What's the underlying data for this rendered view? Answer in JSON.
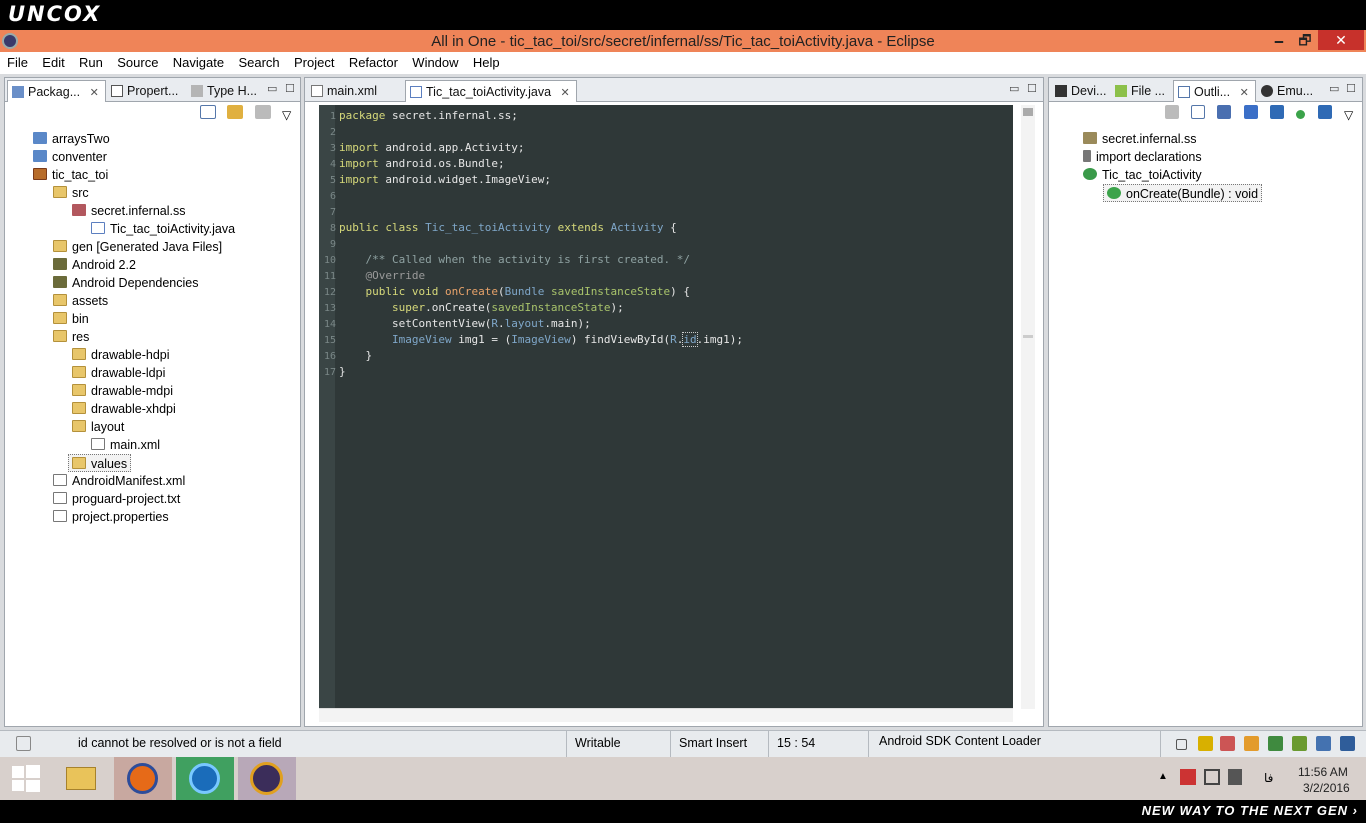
{
  "banner": {
    "logo": "UNCOX",
    "tagline": "NEW WAY TO THE NEXT GEN ›"
  },
  "window": {
    "title": "All in One - tic_tac_toi/src/secret/infernal/ss/Tic_tac_toiActivity.java - Eclipse",
    "min": "🗕",
    "max": "🗗",
    "close": "✕"
  },
  "menu": [
    "File",
    "Edit",
    "Run",
    "Source",
    "Navigate",
    "Search",
    "Project",
    "Refactor",
    "Window",
    "Help"
  ],
  "left_view": {
    "tabs": [
      "Packag...",
      "Propert...",
      "Type H..."
    ],
    "tree": [
      {
        "label": "arraysTwo",
        "icon": "project-icon"
      },
      {
        "label": "conventer",
        "icon": "project-icon"
      },
      {
        "label": "tic_tac_toi",
        "icon": "project-icon"
      },
      {
        "label": "src",
        "icon": "folder-icon"
      },
      {
        "label": "secret.infernal.ss",
        "icon": "package-icon"
      },
      {
        "label": "Tic_tac_toiActivity.java",
        "icon": "java-file-icon"
      },
      {
        "label": "gen [Generated Java Files]",
        "icon": "folder-icon"
      },
      {
        "label": "Android 2.2",
        "icon": "library-icon"
      },
      {
        "label": "Android Dependencies",
        "icon": "library-icon"
      },
      {
        "label": "assets",
        "icon": "folder-icon"
      },
      {
        "label": "bin",
        "icon": "folder-icon"
      },
      {
        "label": "res",
        "icon": "folder-icon"
      },
      {
        "label": "drawable-hdpi",
        "icon": "folder-icon"
      },
      {
        "label": "drawable-ldpi",
        "icon": "folder-icon"
      },
      {
        "label": "drawable-mdpi",
        "icon": "folder-icon"
      },
      {
        "label": "drawable-xhdpi",
        "icon": "folder-icon"
      },
      {
        "label": "layout",
        "icon": "folder-icon"
      },
      {
        "label": "main.xml",
        "icon": "xml-file-icon"
      },
      {
        "label": "values",
        "icon": "folder-icon"
      },
      {
        "label": "AndroidManifest.xml",
        "icon": "file-icon"
      },
      {
        "label": "proguard-project.txt",
        "icon": "file-icon"
      },
      {
        "label": "project.properties",
        "icon": "file-icon"
      }
    ]
  },
  "editor": {
    "tabs": [
      "main.xml",
      "Tic_tac_toiActivity.java"
    ],
    "line_numbers": [
      "1",
      "2",
      "3",
      "4",
      "5",
      "6",
      "7",
      "8",
      "9",
      "10",
      "11",
      "12",
      "13",
      "14",
      "15",
      "16",
      "17"
    ],
    "code": {
      "l1a": "package",
      "l1b": " secret.infernal.ss;",
      "l3a": "import",
      "l3b": " android.app.Activity;",
      "l4a": "import",
      "l4b": " android.os.Bundle;",
      "l5a": "import",
      "l5b": " android.widget.ImageView;",
      "l8a": "public class",
      "l8b": "Tic_tac_toiActivity",
      "l8c": "extends",
      "l8d": "Activity",
      "l8e": " {",
      "l10": "    /** Called when the activity is first created. */",
      "l11": "    @Override",
      "l12a": "    public void",
      "l12b": "onCreate",
      "l12c": "(",
      "l12d": "Bundle",
      "l12e": "savedInstanceState",
      "l12f": ") {",
      "l13a": "        super",
      "l13b": ".onCreate(",
      "l13c": "savedInstanceState",
      "l13d": ");",
      "l14a": "        setContentView(",
      "l14b": "R",
      "l14c": ".",
      "l14d": "layout",
      "l14e": ".main);",
      "l15a": "        ImageView",
      "l15b": " img1 = (",
      "l15c": "ImageView",
      "l15d": ") findViewById(",
      "l15e": "R",
      "l15f": ".",
      "l15g": "id",
      "l15h": ".img1);",
      "l16": "    }",
      "l17": "}"
    }
  },
  "right_view": {
    "tabs": [
      "Devi...",
      "File ...",
      "Outli...",
      "Emu..."
    ],
    "outline": [
      "secret.infernal.ss",
      "import declarations",
      "Tic_tac_toiActivity",
      "onCreate(Bundle) : void"
    ]
  },
  "status": {
    "message": "id cannot be resolved or is not a field",
    "mode": "Writable",
    "insert": "Smart Insert",
    "position": "15 : 54",
    "task": "Android SDK Content Loader"
  },
  "taskbar": {
    "tray_lang": "فا",
    "time": "11:56 AM",
    "date": "3/2/2016"
  },
  "colors": {
    "title_bar": "#ef8458",
    "editor_bg": "#2f3838",
    "close_btn": "#c7312b"
  }
}
